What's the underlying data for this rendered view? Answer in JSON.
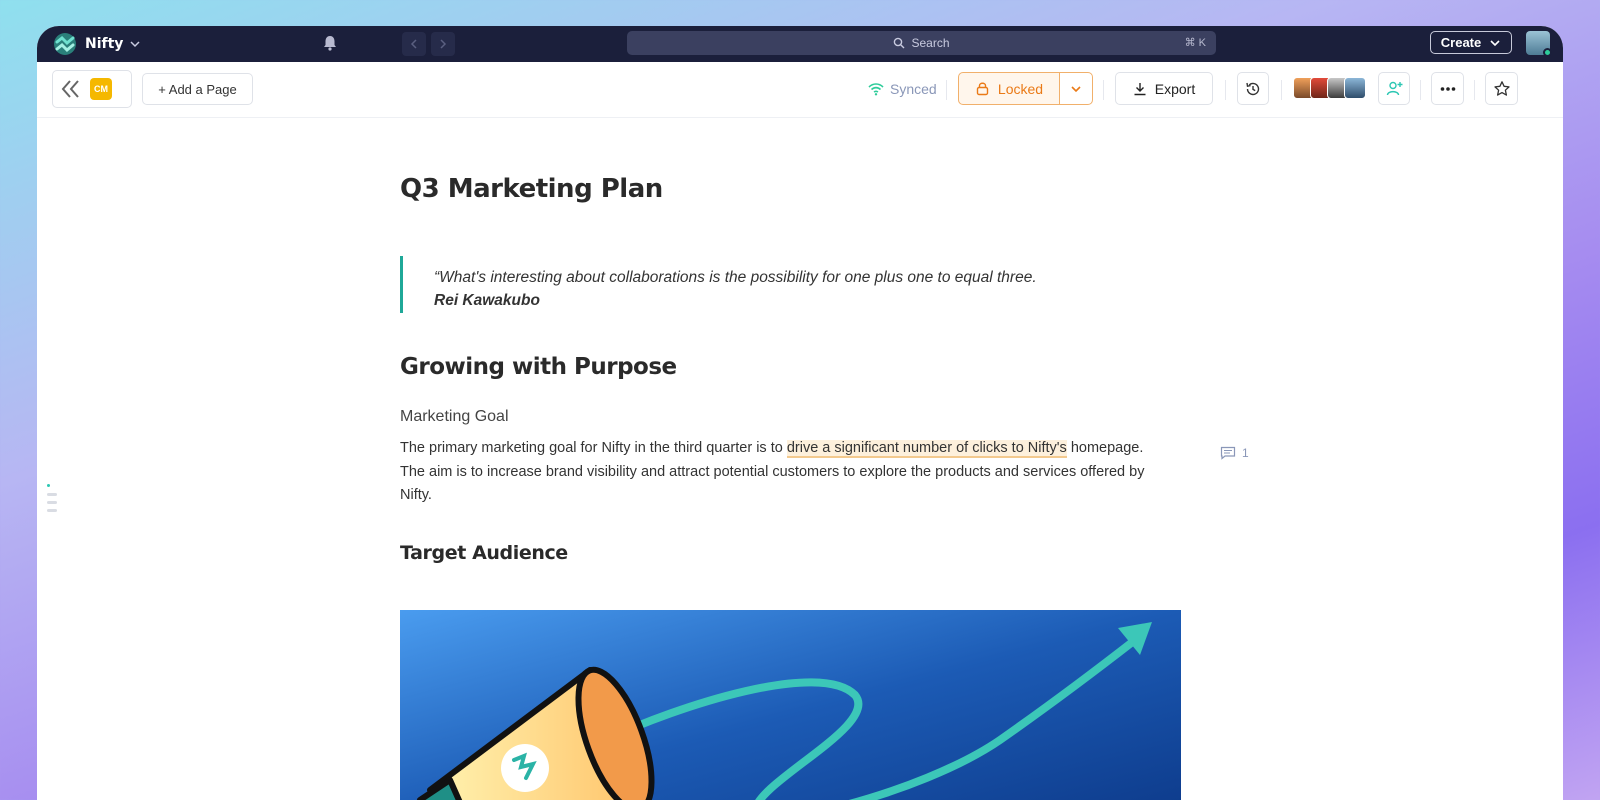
{
  "app": {
    "name": "Nifty",
    "search_placeholder": "Search",
    "search_shortcut": "⌘ K",
    "create_label": "Create"
  },
  "toolbar": {
    "workspace_badge": "CM",
    "add_page_label": "+ Add a Page",
    "sync_status": "Synced",
    "lock_label": "Locked",
    "export_label": "Export"
  },
  "document": {
    "title": "Q3 Marketing Plan",
    "quote": {
      "text": "“What's interesting about collaborations is the possibility for one plus one to equal three.",
      "author": "Rei Kawakubo"
    },
    "section_heading": "Growing with Purpose",
    "goal_label": "Marketing Goal",
    "paragraph": {
      "before": "The primary marketing goal for Nifty in the third quarter is to ",
      "highlight": "drive a significant number of clicks to Nifty's",
      "after": " homepage. The aim is to increase brand visibility and attract potential customers to explore the products and services offered by Nifty."
    },
    "comment_count": "1",
    "subheading": "Target Audience"
  },
  "colors": {
    "topbar": "#1b1f3b",
    "accent": "#1fa898",
    "lock_orange": "#ea7a17",
    "highlight": "#fdf0dc"
  },
  "icons": [
    "nifty-logo-icon",
    "chevron-down-icon",
    "bell-icon",
    "chevron-left-icon",
    "chevron-right-icon",
    "search-icon",
    "double-chevron-left-icon",
    "wifi-icon",
    "lock-icon",
    "download-icon",
    "history-icon",
    "add-member-icon",
    "more-icon",
    "star-icon",
    "comment-icon"
  ]
}
